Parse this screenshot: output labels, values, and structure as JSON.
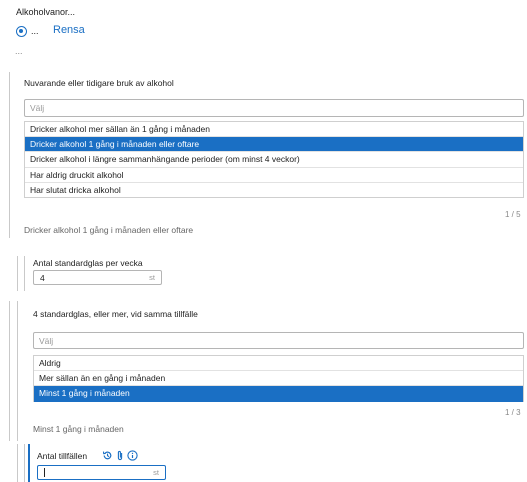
{
  "header": {
    "title": "Alkoholvanor...",
    "radio_label": "...",
    "clear_label": "Rensa",
    "ellipsis": "..."
  },
  "q1": {
    "label": "Nuvarande eller tidigare bruk av alkohol",
    "placeholder": "Välj",
    "options": [
      "Dricker alkohol mer sällan än 1 gång i månaden",
      "Dricker alkohol 1 gång i månaden eller oftare",
      "Dricker alkohol i längre sammanhängande perioder (om minst 4 veckor)",
      "Har aldrig druckit alkohol",
      "Har slutat dricka alkohol"
    ],
    "selected_index": 1,
    "counter": "1 / 5",
    "summary": "Dricker alkohol 1 gång i månaden eller oftare"
  },
  "q_glasses": {
    "label": "Antal standardglas per vecka",
    "value": "4",
    "unit": "st"
  },
  "q2": {
    "label": "4 standardglas, eller mer, vid samma tillfälle",
    "placeholder": "Välj",
    "options": [
      "Aldrig",
      "Mer sällan än en gång i månaden",
      "Minst 1 gång i månaden"
    ],
    "selected_index": 2,
    "counter": "1 / 3",
    "summary": "Minst 1 gång i månaden"
  },
  "q_occasions": {
    "label": "Antal tillfällen",
    "value": "",
    "unit": "st",
    "icons": [
      "history-icon",
      "attachment-icon",
      "info-icon"
    ]
  },
  "colors": {
    "accent": "#1a6fc4",
    "border": "#b5b5b5",
    "rule": "#c9c9c9"
  }
}
